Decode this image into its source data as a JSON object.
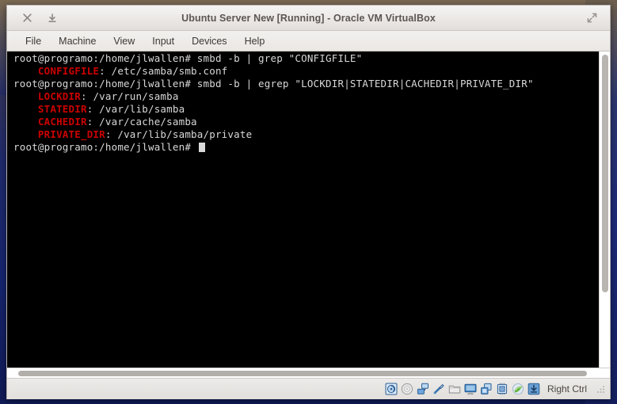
{
  "window": {
    "title": "Ubuntu Server New [Running] - Oracle VM VirtualBox",
    "close_label": "×",
    "minimize_label": "⤓",
    "fullscreen_label": "⤢"
  },
  "menu": {
    "items": [
      {
        "label": "File",
        "name": "menu-file"
      },
      {
        "label": "Machine",
        "name": "menu-machine"
      },
      {
        "label": "View",
        "name": "menu-view"
      },
      {
        "label": "Input",
        "name": "menu-input"
      },
      {
        "label": "Devices",
        "name": "menu-devices"
      },
      {
        "label": "Help",
        "name": "menu-help"
      }
    ]
  },
  "terminal": {
    "prompt": "root@programo:/home/jlwallen#",
    "label_color": "#cc0000",
    "text_color": "#d8d8d8",
    "background_color": "#000000",
    "lines": [
      {
        "type": "command",
        "prompt": "root@programo:/home/jlwallen#",
        "command": " smbd -b | grep \"CONFIGFILE\""
      },
      {
        "type": "output",
        "indent": "    ",
        "label": "CONFIGFILE",
        "separator": ": ",
        "value": "/etc/samba/smb.conf"
      },
      {
        "type": "command",
        "prompt": "root@programo:/home/jlwallen#",
        "command": " smbd -b | egrep \"LOCKDIR|STATEDIR|CACHEDIR|PRIVATE_DIR\""
      },
      {
        "type": "output",
        "indent": "    ",
        "label": "LOCKDIR",
        "separator": ": ",
        "value": "/var/run/samba"
      },
      {
        "type": "output",
        "indent": "    ",
        "label": "STATEDIR",
        "separator": ": ",
        "value": "/var/lib/samba"
      },
      {
        "type": "output",
        "indent": "    ",
        "label": "CACHEDIR",
        "separator": ": ",
        "value": "/var/cache/samba"
      },
      {
        "type": "output",
        "indent": "    ",
        "label": "PRIVATE_DIR",
        "separator": ": ",
        "value": "/var/lib/samba/private"
      },
      {
        "type": "prompt",
        "prompt": "root@programo:/home/jlwallen#",
        "command": " "
      }
    ]
  },
  "status_bar": {
    "host_key": "Right Ctrl",
    "icons": [
      {
        "name": "hard-disk-icon",
        "title": "Hard Disks"
      },
      {
        "name": "optical-disk-icon",
        "title": "Optical Drives"
      },
      {
        "name": "network-icon",
        "title": "Network"
      },
      {
        "name": "usb-icon",
        "title": "USB Devices"
      },
      {
        "name": "shared-folders-icon",
        "title": "Shared Folders"
      },
      {
        "name": "display-icon",
        "title": "Display"
      },
      {
        "name": "video-capture-icon",
        "title": "Video Capture"
      },
      {
        "name": "cpu-icon",
        "title": "Processor"
      },
      {
        "name": "guest-additions-icon",
        "title": "Guest Additions"
      },
      {
        "name": "host-drive-icon",
        "title": "Host Drive"
      }
    ]
  }
}
